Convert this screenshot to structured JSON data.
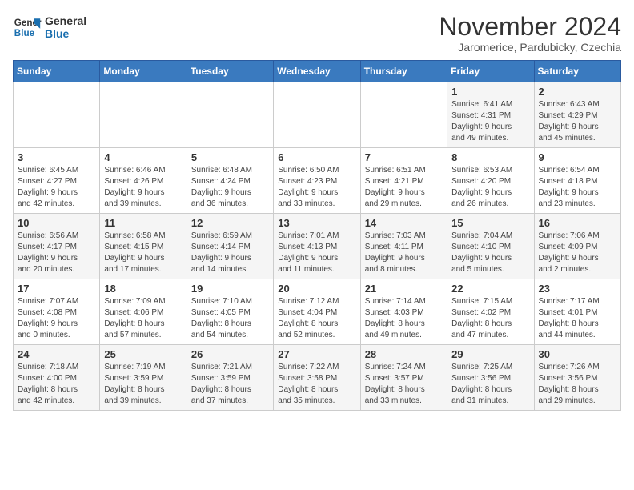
{
  "logo": {
    "line1": "General",
    "line2": "Blue"
  },
  "title": "November 2024",
  "subtitle": "Jaromerice, Pardubicky, Czechia",
  "days_of_week": [
    "Sunday",
    "Monday",
    "Tuesday",
    "Wednesday",
    "Thursday",
    "Friday",
    "Saturday"
  ],
  "weeks": [
    [
      {
        "num": "",
        "info": ""
      },
      {
        "num": "",
        "info": ""
      },
      {
        "num": "",
        "info": ""
      },
      {
        "num": "",
        "info": ""
      },
      {
        "num": "",
        "info": ""
      },
      {
        "num": "1",
        "info": "Sunrise: 6:41 AM\nSunset: 4:31 PM\nDaylight: 9 hours\nand 49 minutes."
      },
      {
        "num": "2",
        "info": "Sunrise: 6:43 AM\nSunset: 4:29 PM\nDaylight: 9 hours\nand 45 minutes."
      }
    ],
    [
      {
        "num": "3",
        "info": "Sunrise: 6:45 AM\nSunset: 4:27 PM\nDaylight: 9 hours\nand 42 minutes."
      },
      {
        "num": "4",
        "info": "Sunrise: 6:46 AM\nSunset: 4:26 PM\nDaylight: 9 hours\nand 39 minutes."
      },
      {
        "num": "5",
        "info": "Sunrise: 6:48 AM\nSunset: 4:24 PM\nDaylight: 9 hours\nand 36 minutes."
      },
      {
        "num": "6",
        "info": "Sunrise: 6:50 AM\nSunset: 4:23 PM\nDaylight: 9 hours\nand 33 minutes."
      },
      {
        "num": "7",
        "info": "Sunrise: 6:51 AM\nSunset: 4:21 PM\nDaylight: 9 hours\nand 29 minutes."
      },
      {
        "num": "8",
        "info": "Sunrise: 6:53 AM\nSunset: 4:20 PM\nDaylight: 9 hours\nand 26 minutes."
      },
      {
        "num": "9",
        "info": "Sunrise: 6:54 AM\nSunset: 4:18 PM\nDaylight: 9 hours\nand 23 minutes."
      }
    ],
    [
      {
        "num": "10",
        "info": "Sunrise: 6:56 AM\nSunset: 4:17 PM\nDaylight: 9 hours\nand 20 minutes."
      },
      {
        "num": "11",
        "info": "Sunrise: 6:58 AM\nSunset: 4:15 PM\nDaylight: 9 hours\nand 17 minutes."
      },
      {
        "num": "12",
        "info": "Sunrise: 6:59 AM\nSunset: 4:14 PM\nDaylight: 9 hours\nand 14 minutes."
      },
      {
        "num": "13",
        "info": "Sunrise: 7:01 AM\nSunset: 4:13 PM\nDaylight: 9 hours\nand 11 minutes."
      },
      {
        "num": "14",
        "info": "Sunrise: 7:03 AM\nSunset: 4:11 PM\nDaylight: 9 hours\nand 8 minutes."
      },
      {
        "num": "15",
        "info": "Sunrise: 7:04 AM\nSunset: 4:10 PM\nDaylight: 9 hours\nand 5 minutes."
      },
      {
        "num": "16",
        "info": "Sunrise: 7:06 AM\nSunset: 4:09 PM\nDaylight: 9 hours\nand 2 minutes."
      }
    ],
    [
      {
        "num": "17",
        "info": "Sunrise: 7:07 AM\nSunset: 4:08 PM\nDaylight: 9 hours\nand 0 minutes."
      },
      {
        "num": "18",
        "info": "Sunrise: 7:09 AM\nSunset: 4:06 PM\nDaylight: 8 hours\nand 57 minutes."
      },
      {
        "num": "19",
        "info": "Sunrise: 7:10 AM\nSunset: 4:05 PM\nDaylight: 8 hours\nand 54 minutes."
      },
      {
        "num": "20",
        "info": "Sunrise: 7:12 AM\nSunset: 4:04 PM\nDaylight: 8 hours\nand 52 minutes."
      },
      {
        "num": "21",
        "info": "Sunrise: 7:14 AM\nSunset: 4:03 PM\nDaylight: 8 hours\nand 49 minutes."
      },
      {
        "num": "22",
        "info": "Sunrise: 7:15 AM\nSunset: 4:02 PM\nDaylight: 8 hours\nand 47 minutes."
      },
      {
        "num": "23",
        "info": "Sunrise: 7:17 AM\nSunset: 4:01 PM\nDaylight: 8 hours\nand 44 minutes."
      }
    ],
    [
      {
        "num": "24",
        "info": "Sunrise: 7:18 AM\nSunset: 4:00 PM\nDaylight: 8 hours\nand 42 minutes."
      },
      {
        "num": "25",
        "info": "Sunrise: 7:19 AM\nSunset: 3:59 PM\nDaylight: 8 hours\nand 39 minutes."
      },
      {
        "num": "26",
        "info": "Sunrise: 7:21 AM\nSunset: 3:59 PM\nDaylight: 8 hours\nand 37 minutes."
      },
      {
        "num": "27",
        "info": "Sunrise: 7:22 AM\nSunset: 3:58 PM\nDaylight: 8 hours\nand 35 minutes."
      },
      {
        "num": "28",
        "info": "Sunrise: 7:24 AM\nSunset: 3:57 PM\nDaylight: 8 hours\nand 33 minutes."
      },
      {
        "num": "29",
        "info": "Sunrise: 7:25 AM\nSunset: 3:56 PM\nDaylight: 8 hours\nand 31 minutes."
      },
      {
        "num": "30",
        "info": "Sunrise: 7:26 AM\nSunset: 3:56 PM\nDaylight: 8 hours\nand 29 minutes."
      }
    ]
  ]
}
